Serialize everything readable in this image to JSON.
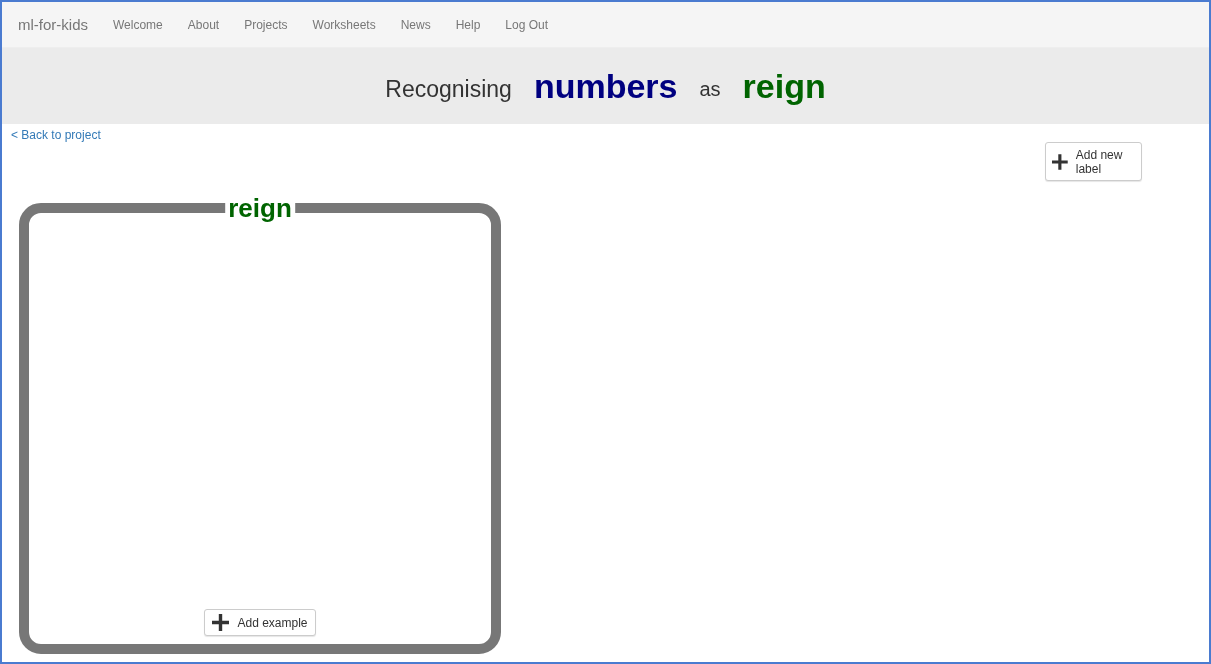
{
  "nav": {
    "brand": "ml-for-kids",
    "links": [
      "Welcome",
      "About",
      "Projects",
      "Worksheets",
      "News",
      "Help",
      "Log Out"
    ]
  },
  "header": {
    "prefix": "Recognising",
    "project_type": "numbers",
    "joiner": "as",
    "target": "reign"
  },
  "back_link": "< Back to project",
  "add_label_button": "Add new label",
  "labels": [
    {
      "name": "reign",
      "add_button": "Add example"
    }
  ]
}
